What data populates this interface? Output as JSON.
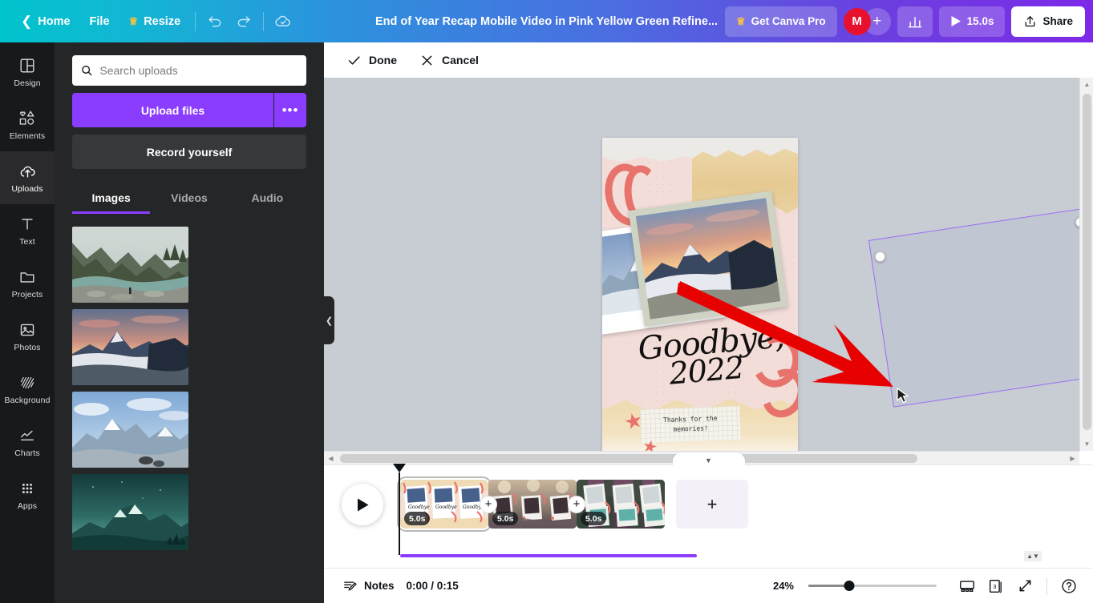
{
  "topbar": {
    "back_label": "Home",
    "file_label": "File",
    "resize_label": "Resize",
    "undo_name": "undo-icon",
    "redo_name": "redo-icon",
    "cloud_name": "cloud-saved-icon",
    "design_title": "End of Year Recap Mobile Video in Pink Yellow Green Refine...",
    "pro_label": "Get Canva Pro",
    "avatar_initial": "M",
    "add_collaborator_label": "+",
    "insights_name": "insights-bar-chart-icon",
    "duration_label": "15.0s",
    "share_label": "Share"
  },
  "rail": {
    "items": [
      {
        "label": "Design",
        "icon": "design-layout-icon",
        "active": false
      },
      {
        "label": "Elements",
        "icon": "elements-shapes-icon",
        "active": false
      },
      {
        "label": "Uploads",
        "icon": "upload-cloud-icon",
        "active": true
      },
      {
        "label": "Text",
        "icon": "text-t-icon",
        "active": false
      },
      {
        "label": "Projects",
        "icon": "folder-icon",
        "active": false
      },
      {
        "label": "Photos",
        "icon": "photo-image-icon",
        "active": false
      },
      {
        "label": "Background",
        "icon": "background-hatch-icon",
        "active": false
      },
      {
        "label": "Charts",
        "icon": "charts-line-icon",
        "active": false
      },
      {
        "label": "Apps",
        "icon": "apps-grid-icon",
        "active": false
      }
    ]
  },
  "panel": {
    "search_placeholder": "Search uploads",
    "search_value": "",
    "upload_label": "Upload files",
    "upload_more_label": "•••",
    "record_label": "Record yourself",
    "tabs": [
      {
        "label": "Images",
        "active": true
      },
      {
        "label": "Videos",
        "active": false
      },
      {
        "label": "Audio",
        "active": false
      }
    ],
    "thumbnails": [
      {
        "alt": "forest river valley with person standing"
      },
      {
        "alt": "mountain sunset above clouds"
      },
      {
        "alt": "snowy mountain peaks blue sky"
      },
      {
        "alt": "teal mountain silhouette at dusk"
      }
    ],
    "collapse_icon": "chevron-left-icon"
  },
  "crop_bar": {
    "done_label": "Done",
    "cancel_label": "Cancel"
  },
  "canvas": {
    "design_text": {
      "headline": "Goodbye,",
      "year": "2022",
      "note_line1": "Thanks for the",
      "note_line2": "memories!"
    },
    "comment_button_name": "add-comment-icon",
    "selection": {
      "handles": 3,
      "color": "#9b6cf5"
    },
    "annotation": {
      "type": "red-arrow",
      "color": "#e60000"
    }
  },
  "timeline": {
    "collapse_icon": "chevron-down-icon",
    "play_label": "play",
    "scenes": [
      {
        "duration": "5.0s",
        "selected": true,
        "alt": "pink scrapbook scene with photo frames"
      },
      {
        "duration": "5.0s",
        "selected": false,
        "alt": "dark sunset scene with polaroid frames"
      },
      {
        "duration": "5.0s",
        "selected": false,
        "alt": "green beach scene with photo frames"
      }
    ],
    "add_scene_label": "+",
    "add_between_label": "+"
  },
  "statusbar": {
    "notes_label": "Notes",
    "time_label": "0:00 / 0:15",
    "zoom_label": "24%",
    "zoom_value": 24,
    "page_count": "3",
    "icons": {
      "present": "presentation-screen-icon",
      "pages": "page-manager-icon",
      "fullscreen": "fullscreen-expand-icon",
      "help": "help-question-icon"
    }
  }
}
